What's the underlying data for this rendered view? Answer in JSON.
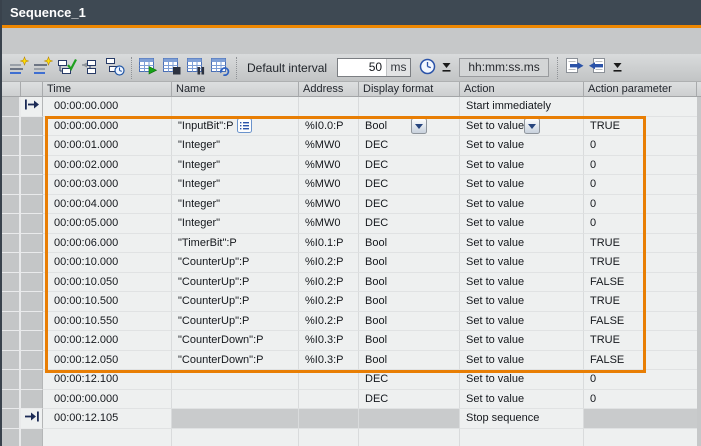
{
  "window": {
    "title": "Sequence_1"
  },
  "colors": {
    "titlebar": "#3e4953",
    "accent_orange": "#ee8700",
    "selection_frame": "#e87e04",
    "row_background": "#eef0f0",
    "disabled_cell": "#c9cbcc"
  },
  "toolbar": {
    "default_interval_label": "Default interval",
    "interval_value": "50",
    "interval_unit": "ms",
    "time_format": "hh:mm:ss.ms",
    "icons": [
      "add-step-icon",
      "add-step-alt-icon",
      "apply-steps-check-icon",
      "insert-step-arrow-icon",
      "step-time-clock-icon",
      "table-play-icon",
      "table-stop-icon",
      "table-pause-icon",
      "table-repeat-icon",
      "clock-icon",
      "dropdown-arrow-icon",
      "export-icon",
      "import-icon"
    ]
  },
  "table": {
    "columns": [
      "Time",
      "Name",
      "Address",
      "Display format",
      "Action",
      "Action parameter"
    ],
    "selection": {
      "first_row_index": 1,
      "last_row_index": 13
    },
    "rows": [
      {
        "time": "00:00:00.000",
        "name": "",
        "address": "",
        "format": "",
        "action": "Start immediately",
        "param": "",
        "marker": "start"
      },
      {
        "time": "00:00:00.000",
        "name": "\"InputBit\":P",
        "address": "%I0.0:P",
        "format": "Bool",
        "action": "Set to value",
        "param": "TRUE",
        "editors": true,
        "selected": true
      },
      {
        "time": "00:00:01.000",
        "name": "\"Integer\"",
        "address": "%MW0",
        "format": "DEC",
        "action": "Set to value",
        "param": "0"
      },
      {
        "time": "00:00:02.000",
        "name": "\"Integer\"",
        "address": "%MW0",
        "format": "DEC",
        "action": "Set to value",
        "param": "0"
      },
      {
        "time": "00:00:03.000",
        "name": "\"Integer\"",
        "address": "%MW0",
        "format": "DEC",
        "action": "Set to value",
        "param": "0"
      },
      {
        "time": "00:00:04.000",
        "name": "\"Integer\"",
        "address": "%MW0",
        "format": "DEC",
        "action": "Set to value",
        "param": "0"
      },
      {
        "time": "00:00:05.000",
        "name": "\"Integer\"",
        "address": "%MW0",
        "format": "DEC",
        "action": "Set to value",
        "param": "0"
      },
      {
        "time": "00:00:06.000",
        "name": "\"TimerBit\":P",
        "address": "%I0.1:P",
        "format": "Bool",
        "action": "Set to value",
        "param": "TRUE"
      },
      {
        "time": "00:00:10.000",
        "name": "\"CounterUp\":P",
        "address": "%I0.2:P",
        "format": "Bool",
        "action": "Set to value",
        "param": "TRUE"
      },
      {
        "time": "00:00:10.050",
        "name": "\"CounterUp\":P",
        "address": "%I0.2:P",
        "format": "Bool",
        "action": "Set to value",
        "param": "FALSE"
      },
      {
        "time": "00:00:10.500",
        "name": "\"CounterUp\":P",
        "address": "%I0.2:P",
        "format": "Bool",
        "action": "Set to value",
        "param": "TRUE"
      },
      {
        "time": "00:00:10.550",
        "name": "\"CounterUp\":P",
        "address": "%I0.2:P",
        "format": "Bool",
        "action": "Set to value",
        "param": "FALSE"
      },
      {
        "time": "00:00:12.000",
        "name": "\"CounterDown\":P",
        "address": "%I0.3:P",
        "format": "Bool",
        "action": "Set to value",
        "param": "TRUE"
      },
      {
        "time": "00:00:12.050",
        "name": "\"CounterDown\":P",
        "address": "%I0.3:P",
        "format": "Bool",
        "action": "Set to value",
        "param": "FALSE"
      },
      {
        "time": "00:00:12.100",
        "name": "",
        "address": "",
        "format": "DEC",
        "action": "Set to value",
        "param": "0"
      },
      {
        "time": "00:00:00.000",
        "name": "",
        "address": "",
        "format": "DEC",
        "action": "Set to value",
        "param": "0"
      },
      {
        "time": "00:00:12.105",
        "name": "",
        "address": "",
        "format": "",
        "action": "Stop sequence",
        "param": "",
        "marker": "stop",
        "disabled": [
          "name",
          "address",
          "format",
          "param"
        ]
      },
      {
        "time": "",
        "name": "",
        "address": "",
        "format": "",
        "action": "",
        "param": ""
      }
    ]
  }
}
